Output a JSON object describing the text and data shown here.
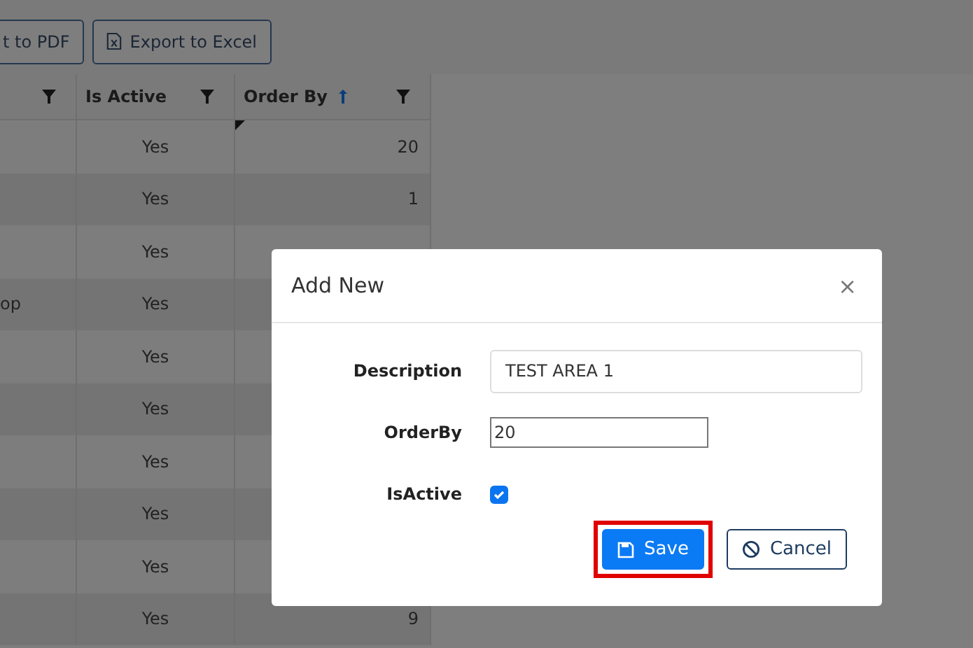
{
  "toolbar": {
    "buttons": [
      {
        "label": "t to PDF",
        "kind": "pdf"
      },
      {
        "label": "Export to Excel",
        "kind": "excel"
      }
    ]
  },
  "table": {
    "columns": [
      {
        "filter": true,
        "sorted": false
      },
      {
        "label": "Is Active",
        "filter": true,
        "sorted": false
      },
      {
        "label": "Order By",
        "filter": true,
        "sorted": true
      }
    ],
    "rows": [
      {
        "is_active": "Yes",
        "order_by": "20",
        "edited": true
      },
      {
        "is_active": "Yes",
        "order_by": "1",
        "edited": false
      },
      {
        "is_active": "Yes",
        "edited": false
      },
      {
        "column_1": "op",
        "is_active": "Yes",
        "edited": false
      },
      {
        "is_active": "Yes",
        "edited": false
      },
      {
        "is_active": "Yes",
        "edited": false
      },
      {
        "is_active": "Yes",
        "edited": false
      },
      {
        "is_active": "Yes",
        "edited": false
      },
      {
        "is_active": "Yes",
        "edited": false
      },
      {
        "is_active": "Yes",
        "order_by": "9",
        "edited": false
      }
    ]
  },
  "dialog": {
    "title": "Add New",
    "close": "×",
    "fields": [
      {
        "label": "Description",
        "kind": "text",
        "value": "TEST AREA 1"
      },
      {
        "label": "OrderBy",
        "kind": "number",
        "value": "20"
      },
      {
        "label": "IsActive",
        "kind": "checkbox",
        "checked": true
      }
    ],
    "buttons": [
      {
        "label": "Save",
        "kind": "save",
        "highlighted": true
      },
      {
        "label": "Cancel",
        "kind": "cancel",
        "highlighted": false
      }
    ]
  }
}
